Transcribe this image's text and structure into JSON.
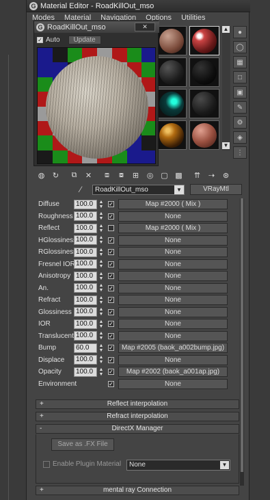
{
  "window": {
    "title": "Material Editor - RoadKillOut_mso"
  },
  "menu": [
    "Modes",
    "Material",
    "Navigation",
    "Options",
    "Utilities"
  ],
  "preview": {
    "title": "RoadKillOut_mso",
    "close": "✕",
    "auto_label": "Auto",
    "update_label": "Update"
  },
  "material": {
    "name": "RoadKillOut_mso",
    "type": "VRayMtl"
  },
  "params": [
    {
      "label": "Diffuse",
      "value": "100.0",
      "checked": true,
      "map": "Map #2000  ( Mix )"
    },
    {
      "label": "Roughness",
      "value": "100.0",
      "checked": true,
      "map": "None"
    },
    {
      "label": "Reflect",
      "value": "100.0",
      "checked": false,
      "map": "Map #2000  ( Mix )"
    },
    {
      "label": "HGlossiness",
      "value": "100.0",
      "checked": true,
      "map": "None"
    },
    {
      "label": "RGlossiness",
      "value": "100.0",
      "checked": true,
      "map": "None"
    },
    {
      "label": "Fresnel IOR",
      "value": "100.0",
      "checked": true,
      "map": "None"
    },
    {
      "label": "Anisotropy",
      "value": "100.0",
      "checked": true,
      "map": "None"
    },
    {
      "label": "An.",
      "value": "100.0",
      "checked": true,
      "map": "None"
    },
    {
      "label": "Refract",
      "value": "100.0",
      "checked": true,
      "map": "None"
    },
    {
      "label": "Glossiness",
      "value": "100.0",
      "checked": true,
      "map": "None"
    },
    {
      "label": "IOR",
      "value": "100.0",
      "checked": true,
      "map": "None"
    },
    {
      "label": "Translucent",
      "value": "100.0",
      "checked": true,
      "map": "None"
    },
    {
      "label": "Bump",
      "value": "60.0",
      "checked": true,
      "map": "Map #2005 (baok_a002bump.jpg)"
    },
    {
      "label": "Displace",
      "value": "100.0",
      "checked": true,
      "map": "None"
    },
    {
      "label": "Opacity",
      "value": "100.0",
      "checked": true,
      "map": "Map #2002 (baok_a001ap.jpg)"
    },
    {
      "label": "Environment",
      "value": "",
      "checked": true,
      "map": "None"
    }
  ],
  "rollouts": {
    "reflect": {
      "sign": "+",
      "label": "Reflect interpolation"
    },
    "refract": {
      "sign": "+",
      "label": "Refract interpolation"
    },
    "directx": {
      "sign": "-",
      "label": "DirectX Manager"
    },
    "mentalray": {
      "sign": "+",
      "label": "mental ray Connection"
    }
  },
  "directx": {
    "save_fx": "Save as .FX File",
    "enable_plugin": "Enable Plugin Material",
    "plugin_value": "None"
  },
  "colors": {
    "accent": "#c8a040",
    "panel_bg": "#444444"
  }
}
